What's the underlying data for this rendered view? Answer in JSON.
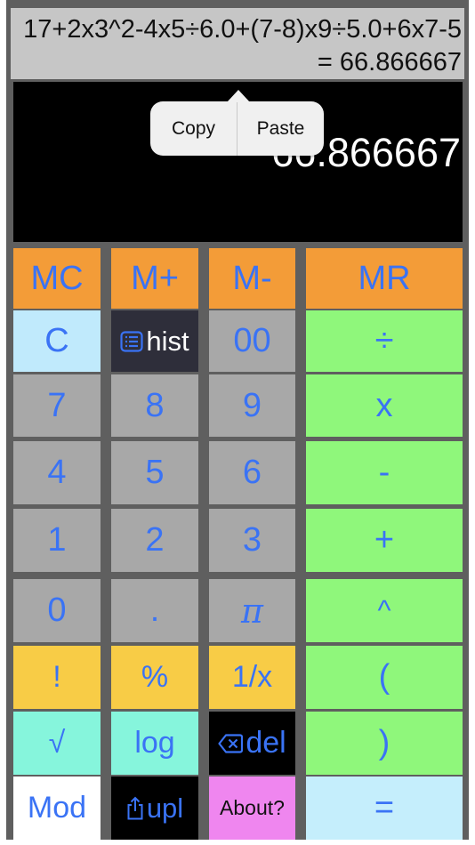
{
  "expression": {
    "text": "17+2x3^2-4x5÷6.0+(7-8)x9÷5.0+6x7-5",
    "result": "= 66.866667"
  },
  "display": {
    "value": "66.866667"
  },
  "context_menu": {
    "copy_label": "Copy",
    "paste_label": "Paste"
  },
  "keys": {
    "mc": "MC",
    "m_plus": "M+",
    "m_minus": "M-",
    "mr": "MR",
    "clear": "C",
    "hist": "hist",
    "double_zero": "00",
    "divide": "÷",
    "seven": "7",
    "eight": "8",
    "nine": "9",
    "multiply": "x",
    "four": "4",
    "five": "5",
    "six": "6",
    "minus": "-",
    "one": "1",
    "two": "2",
    "three": "3",
    "plus": "+",
    "zero": "0",
    "dot": ".",
    "pi": "π",
    "power": "^",
    "factorial": "!",
    "percent": "%",
    "reciprocal": "1/x",
    "open_paren": "(",
    "sqrt": "√",
    "log": "log",
    "del": "del",
    "close_paren": ")",
    "mod": "Mod",
    "upl": "upl",
    "about": "About?",
    "equals": "="
  },
  "icons": {
    "hist": "list-icon",
    "del": "backspace-icon",
    "upl": "share-icon"
  },
  "colors": {
    "key_text": "#3a73f5",
    "memory": "#f39c38",
    "digits": "#a8a8a8",
    "operators": "#8ff77b",
    "functions": "#f8cc46",
    "display_bg": "#000000"
  }
}
